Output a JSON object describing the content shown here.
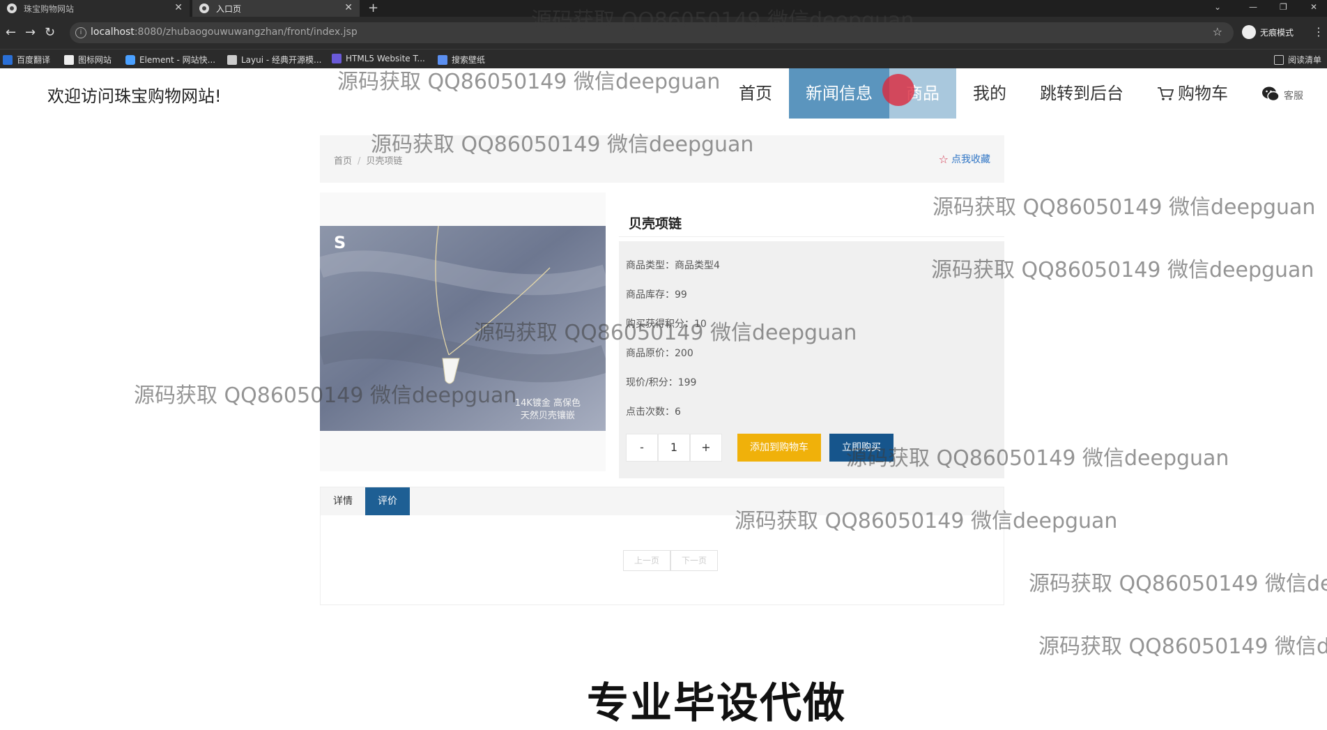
{
  "browser": {
    "tabs": [
      {
        "title": "珠宝购物网站"
      },
      {
        "title": "入口页"
      }
    ],
    "new_tab": "+",
    "url_host": "localhost",
    "url_path": ":8080/zhubaogouwuwangzhan/front/index.jsp",
    "profile_label": "无痕模式",
    "bookmarks": [
      "百度翻译",
      "图标网站",
      "Element - 网站快...",
      "Layui - 经典开源模...",
      "HTML5 Website T...",
      "搜索壁纸"
    ],
    "reading_list": "阅读清单"
  },
  "site": {
    "welcome": "欢迎访问珠宝购物网站!",
    "nav": [
      "首页",
      "新闻信息",
      "商品",
      "我的",
      "跳转到后台",
      "购物车"
    ],
    "service": "客服"
  },
  "breadcrumb": {
    "home": "首页",
    "sep": "/",
    "current": "贝壳项链"
  },
  "favorite": "点我收藏",
  "product": {
    "image_brand": "S",
    "image_caption": [
      "14K镀金 高保色",
      "天然贝壳镶嵌"
    ],
    "title": "贝壳项链",
    "props": [
      "商品类型：商品类型4",
      "商品库存：99",
      "购买获得积分：10",
      "商品原价：200",
      "现价/积分：199",
      "点击次数：6"
    ],
    "qty_minus": "-",
    "qty_value": "1",
    "qty_plus": "+",
    "add_to_cart": "添加到购物车",
    "buy_now": "立即购买"
  },
  "tabs": [
    "详情",
    "评价"
  ],
  "pager": {
    "prev": "上一页",
    "next": "下一页"
  },
  "watermark": "源码获取 QQ86050149 微信deepguan",
  "slogan": "专业毕设代做"
}
